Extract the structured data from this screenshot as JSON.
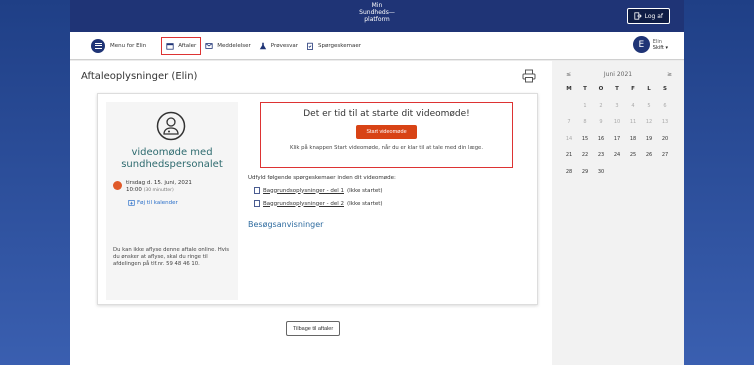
{
  "brand": {
    "line1": "Min",
    "line2": "Sundheds—",
    "line3": "platform"
  },
  "header": {
    "logout_label": "Log af"
  },
  "nav": {
    "menu_label": "Menu for Elin",
    "items": [
      {
        "label": "Aftaler",
        "icon": "calendar-icon",
        "active": true
      },
      {
        "label": "Meddelelser",
        "icon": "mail-icon"
      },
      {
        "label": "Prøvesvar",
        "icon": "flask-icon"
      },
      {
        "label": "Spørgeskemaer",
        "icon": "clipboard-icon"
      }
    ]
  },
  "user": {
    "initial": "E",
    "name": "Elin",
    "switch_label": "Skift ▾"
  },
  "page": {
    "title": "Aftaleoplysninger (Elin)"
  },
  "appointment": {
    "title_line1": "videomøde med",
    "title_line2": "sundhedspersonalet",
    "date": "tirsdag d. 15. juni, 2021",
    "time": "10:00",
    "duration": "(30 minutter)",
    "add_to_calendar": "Føj til kalender",
    "cancel_note": "Du kan ikke aflyse denne aftale online. Hvis du ønsker at aflyse, skal du ringe til afdelingen på tlf.nr. 59 48 46 10."
  },
  "video": {
    "heading": "Det er tid til at starte dit videomøde!",
    "button": "Start videomøde",
    "hint": "Klik på knappen Start videomøde, når du er klar til at tale med din læge."
  },
  "forms": {
    "intro": "Udfyld følgende spørgeskemaer inden dit videomøde:",
    "items": [
      {
        "link": "Baggrundsoplysninger - del 1",
        "status": "(Ikke startet)"
      },
      {
        "link": "Baggrundsoplysninger - del 2",
        "status": "(Ikke startet)"
      }
    ]
  },
  "visit_link": "Besøgsanvisninger",
  "back_button": "Tilbage til aftaler",
  "calendar": {
    "prev": "≤",
    "next": "≥",
    "month": "Juni 2021",
    "dow": [
      "M",
      "T",
      "O",
      "T",
      "F",
      "L",
      "S"
    ],
    "days": [
      "",
      "1",
      "2",
      "3",
      "4",
      "5",
      "6",
      "7",
      "8",
      "9",
      "10",
      "11",
      "12",
      "13",
      "14",
      "15",
      "16",
      "17",
      "18",
      "19",
      "20",
      "21",
      "22",
      "23",
      "24",
      "25",
      "26",
      "27",
      "28",
      "29",
      "30"
    ]
  },
  "colors": {
    "header": "#1f3476",
    "accent": "#d84315",
    "highlight": "#dd3333",
    "link": "#2a6fc9"
  }
}
